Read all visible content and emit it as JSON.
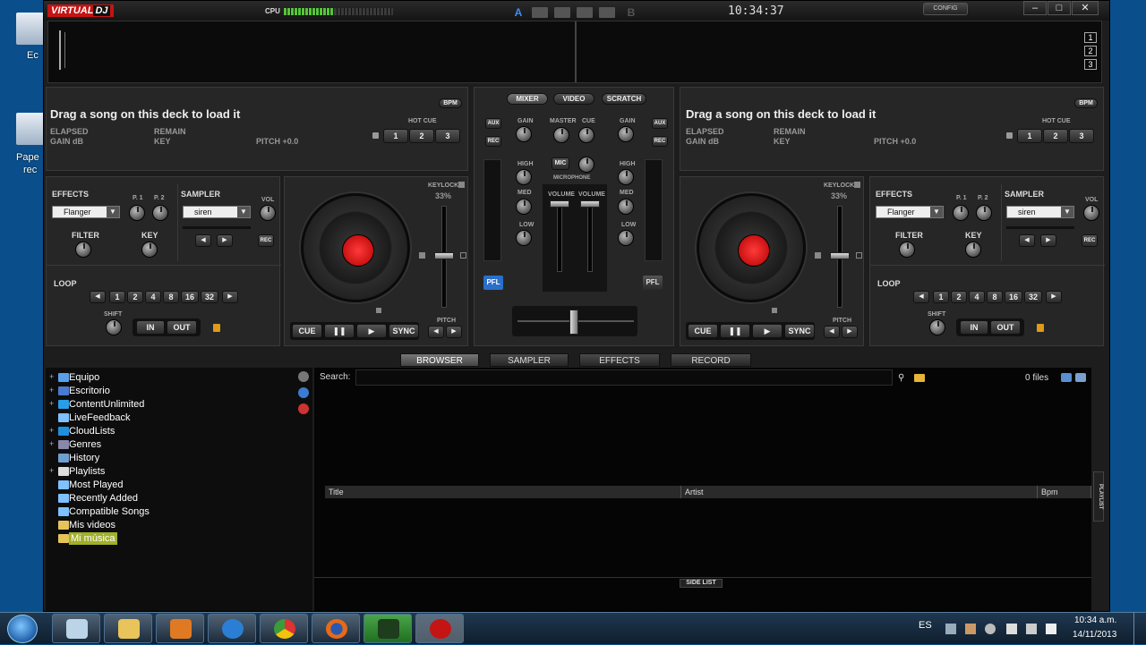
{
  "desktop": {
    "icon1_label": "Ec",
    "icon2_label1": "Pape",
    "icon2_label2": "rec"
  },
  "titlebar": {
    "logo_a": "VIRTUAL",
    "logo_b": "DJ",
    "cpu_label": "CPU",
    "cpu_load": 0.45,
    "ab_a": "A",
    "ab_b": "B",
    "clock": "10:34:37",
    "config": "CONFIG"
  },
  "wave": {
    "deck_numbers": [
      "1",
      "2",
      "3"
    ]
  },
  "deck_left": {
    "drag_text": "Drag a song on this deck to load it",
    "bpm_btn": "BPM",
    "elapsed": "ELAPSED",
    "remain": "REMAIN",
    "gain_db": "GAIN dB",
    "key": "KEY",
    "pitch": "PITCH +0.0",
    "hot_cue": "HOT CUE",
    "hot_cues": [
      "1",
      "2",
      "3"
    ],
    "effects": "EFFECTS",
    "p1": "P. 1",
    "p2": "P. 2",
    "effect_value": "Flanger",
    "sampler": "SAMPLER",
    "vol": "VOL",
    "sampler_value": "siren",
    "rec": "REC",
    "filter": "FILTER",
    "key_knob": "KEY",
    "loop": "LOOP",
    "loop_values": [
      "1",
      "2",
      "4",
      "8",
      "16",
      "32"
    ],
    "shift": "SHIFT",
    "in": "IN",
    "out": "OUT",
    "keylock": "KEYLOCK",
    "keylock_pct": "33%",
    "pitch_lbl": "PITCH",
    "cue": "CUE",
    "sync": "SYNC"
  },
  "deck_right": {
    "drag_text": "Drag a song on this deck to load it",
    "bpm_btn": "BPM",
    "elapsed": "ELAPSED",
    "remain": "REMAIN",
    "gain_db": "GAIN dB",
    "key": "KEY",
    "pitch": "PITCH +0.0",
    "hot_cue": "HOT CUE",
    "hot_cues": [
      "1",
      "2",
      "3"
    ],
    "effects": "EFFECTS",
    "p1": "P. 1",
    "p2": "P. 2",
    "effect_value": "Flanger",
    "sampler": "SAMPLER",
    "vol": "VOL",
    "sampler_value": "siren",
    "rec": "REC",
    "filter": "FILTER",
    "key_knob": "KEY",
    "loop": "LOOP",
    "loop_values": [
      "1",
      "2",
      "4",
      "8",
      "16",
      "32"
    ],
    "shift": "SHIFT",
    "in": "IN",
    "out": "OUT",
    "keylock": "KEYLOCK",
    "keylock_pct": "33%",
    "pitch_lbl": "PITCH",
    "cue": "CUE",
    "sync": "SYNC"
  },
  "mixer": {
    "tabs": [
      "MIXER",
      "VIDEO",
      "SCRATCH"
    ],
    "aux": "AUX",
    "rec": "REC",
    "gain": "GAIN",
    "master": "MASTER",
    "cue": "CUE",
    "high": "HIGH",
    "med": "MED",
    "low": "LOW",
    "mic": "MIC",
    "microphone": "MICROPHONE",
    "volume": "VOLUME",
    "pfl": "PFL"
  },
  "browser": {
    "tabs": [
      "BROWSER",
      "SAMPLER",
      "EFFECTS",
      "RECORD"
    ],
    "search_label": "Search:",
    "files_count": "0 files",
    "tree": [
      {
        "label": "Equipo",
        "plus": "+"
      },
      {
        "label": "Escritorio",
        "plus": "+"
      },
      {
        "label": "ContentUnlimited",
        "plus": "+"
      },
      {
        "label": "LiveFeedback",
        "plus": ""
      },
      {
        "label": "CloudLists",
        "plus": "+"
      },
      {
        "label": "Genres",
        "plus": "+"
      },
      {
        "label": "History",
        "plus": ""
      },
      {
        "label": "Playlists",
        "plus": "+"
      },
      {
        "label": "Most Played",
        "plus": ""
      },
      {
        "label": "Recently Added",
        "plus": ""
      },
      {
        "label": "Compatible Songs",
        "plus": ""
      },
      {
        "label": "Mis videos",
        "plus": ""
      },
      {
        "label": "Mi música",
        "plus": ""
      }
    ],
    "columns": [
      "Title",
      "Artist",
      "Bpm"
    ],
    "playlist_tab": "PLAYLIST",
    "side_list": "SIDE LIST"
  },
  "taskbar": {
    "lang": "ES",
    "time": "10:34 a.m.",
    "date": "14/11/2013"
  },
  "colors": {
    "accent_red": "#c41414",
    "cpu_green": "#57c53a",
    "pfl_blue": "#2a6fc9",
    "tree_selected": "#a0b02a"
  }
}
